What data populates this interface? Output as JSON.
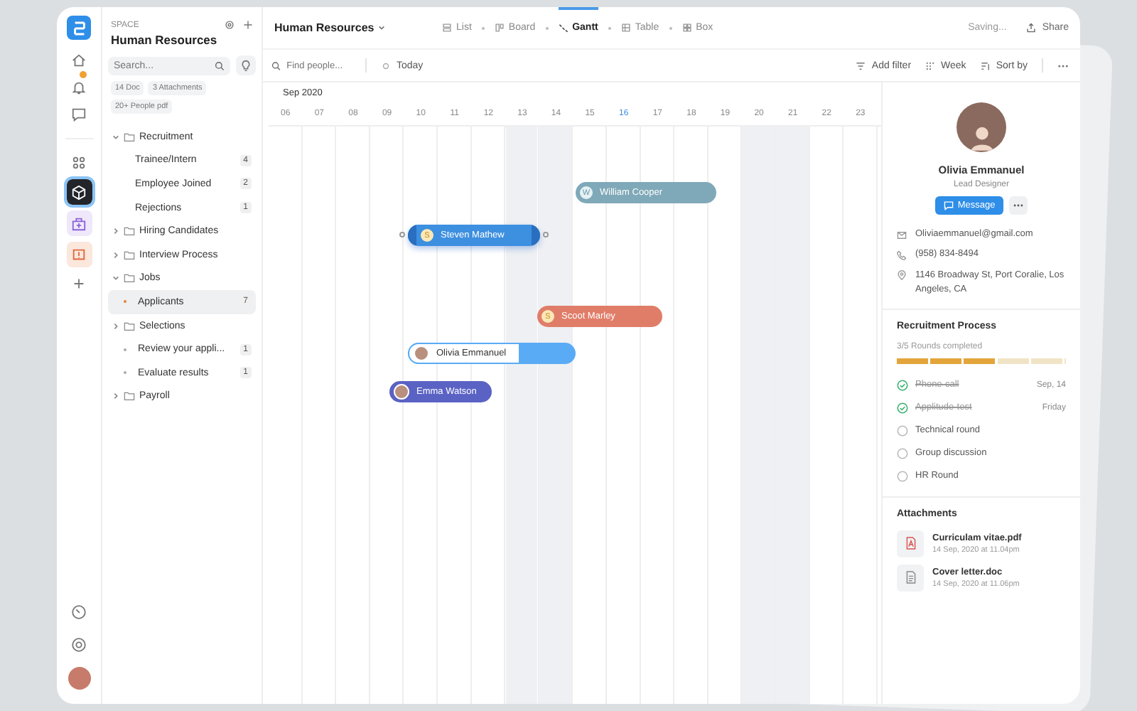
{
  "rail": {
    "items": [
      {
        "kind": "home",
        "selected": false
      },
      {
        "kind": "bell",
        "selected": false
      },
      {
        "kind": "chat",
        "selected": false
      },
      {
        "kind": "apps",
        "selected": false
      },
      {
        "kind": "cube",
        "selected": true
      },
      {
        "kind": "medkit",
        "selected": false
      },
      {
        "kind": "alert",
        "selected": false
      },
      {
        "kind": "add",
        "selected": false
      }
    ],
    "bottom": [
      {
        "kind": "gauge"
      },
      {
        "kind": "support"
      },
      {
        "kind": "avatar"
      }
    ]
  },
  "sidebar": {
    "section_label": "SPACE",
    "title": "Human Resources",
    "search": {
      "placeholder": "Search..."
    },
    "chips": [
      "14 Doc",
      "3 Attachments",
      "20+ People pdf"
    ],
    "tree": [
      {
        "label": "Recruitment",
        "expanded": true,
        "selected": false,
        "children": [
          {
            "label": "Trainee/Intern",
            "kind": "plain",
            "count": "4",
            "selected": false
          },
          {
            "label": "Employee Joined",
            "kind": "plain",
            "count": "2",
            "selected": false
          },
          {
            "label": "Rejections",
            "kind": "plain",
            "count": "1",
            "selected": false
          }
        ]
      },
      {
        "label": "Hiring Candidates",
        "expanded": false,
        "selected": false
      },
      {
        "label": "Interview Process",
        "expanded": false,
        "selected": false
      },
      {
        "label": "Jobs",
        "expanded": true,
        "selected": false,
        "children": [
          {
            "label": "Applicants",
            "kind": "dot",
            "count": "7",
            "selected": true
          }
        ]
      },
      {
        "label": "Selections",
        "expanded": false,
        "selected": false,
        "children": [
          {
            "label": "Review your appli...",
            "kind": "dot",
            "count": "1",
            "selected": false
          },
          {
            "label": "Evaluate results",
            "kind": "dot",
            "count": "1",
            "selected": false
          }
        ]
      },
      {
        "label": "Payroll",
        "expanded": false,
        "selected": false
      }
    ]
  },
  "header": {
    "title": "Human Resources",
    "views": [
      {
        "label": "List",
        "kind": "list",
        "selected": false
      },
      {
        "label": "Board",
        "kind": "board",
        "selected": false
      },
      {
        "label": "Gantt",
        "kind": "gantt",
        "selected": true
      },
      {
        "label": "Table",
        "kind": "table",
        "selected": false
      },
      {
        "label": "Box",
        "kind": "box",
        "selected": false
      }
    ],
    "status": "Saving...",
    "share": "Share"
  },
  "toolbar": {
    "search": {
      "placeholder": "Find people..."
    },
    "today": "Today",
    "add_filter": "Add filter",
    "week": "Week",
    "sort": "Sort by"
  },
  "gantt": {
    "month": "Sep 2020",
    "days": [
      {
        "label": "06",
        "weekend": false,
        "selected": false
      },
      {
        "label": "07",
        "weekend": false,
        "selected": false
      },
      {
        "label": "08",
        "weekend": false,
        "selected": false
      },
      {
        "label": "09",
        "weekend": false,
        "selected": false
      },
      {
        "label": "10",
        "weekend": false,
        "selected": false
      },
      {
        "label": "11",
        "weekend": false,
        "selected": false
      },
      {
        "label": "12",
        "weekend": false,
        "selected": false
      },
      {
        "label": "13",
        "weekend": true,
        "selected": false
      },
      {
        "label": "14",
        "weekend": true,
        "selected": false
      },
      {
        "label": "15",
        "weekend": false,
        "selected": false
      },
      {
        "label": "16",
        "weekend": false,
        "selected": true
      },
      {
        "label": "17",
        "weekend": false,
        "selected": false
      },
      {
        "label": "18",
        "weekend": false,
        "selected": false
      },
      {
        "label": "19",
        "weekend": false,
        "selected": false
      },
      {
        "label": "20",
        "weekend": true,
        "selected": false
      },
      {
        "label": "21",
        "weekend": true,
        "selected": false
      },
      {
        "label": "22",
        "weekend": false,
        "selected": false
      },
      {
        "label": "23",
        "weekend": false,
        "selected": false
      }
    ],
    "bars": [
      {
        "name": "William Cooper",
        "initial": "W",
        "kind": "letter",
        "color": "#7fa9b8",
        "selected": false
      },
      {
        "name": "Steven Mathew",
        "initial": "S",
        "kind": "letter",
        "color": "#3d8fe0",
        "selected": true
      },
      {
        "name": "Scoot Marley",
        "initial": "S",
        "kind": "letter",
        "color": "#e07d68",
        "selected": false
      },
      {
        "name": "Olivia Emmanuel",
        "kind": "split",
        "color": "#5aabf5",
        "selected": false
      },
      {
        "name": "Emma Watson",
        "kind": "photo",
        "color": "#5a62c4",
        "selected": false
      }
    ]
  },
  "profile": {
    "name": "Olivia Emmanuel",
    "role": "Lead Designer",
    "message": "Message",
    "email": "Oliviaemmanuel@gmail.com",
    "phone": "(958) 834-8494",
    "address": "1146  Broadway St, Port Coralie, Los Angeles, CA"
  },
  "recruitment": {
    "title": "Recruitment Process",
    "summary": "3/5 Rounds completed",
    "level": 0.6,
    "steps": [
      {
        "label": "Phone-call",
        "done": true,
        "date": "Sep, 14"
      },
      {
        "label": "Applitude-test",
        "done": true,
        "date": "Friday"
      },
      {
        "label": "Technical round",
        "done": false
      },
      {
        "label": "Group discussion",
        "done": false
      },
      {
        "label": "HR Round",
        "done": false
      }
    ]
  },
  "attachments": {
    "title": "Attachments",
    "files": [
      {
        "name": "Curriculam vitae.pdf",
        "date": "14 Sep, 2020 at 11.04pm",
        "kind": "pdf"
      },
      {
        "name": "Cover letter.doc",
        "date": "14 Sep, 2020 at 11.06pm",
        "kind": "doc"
      }
    ]
  }
}
